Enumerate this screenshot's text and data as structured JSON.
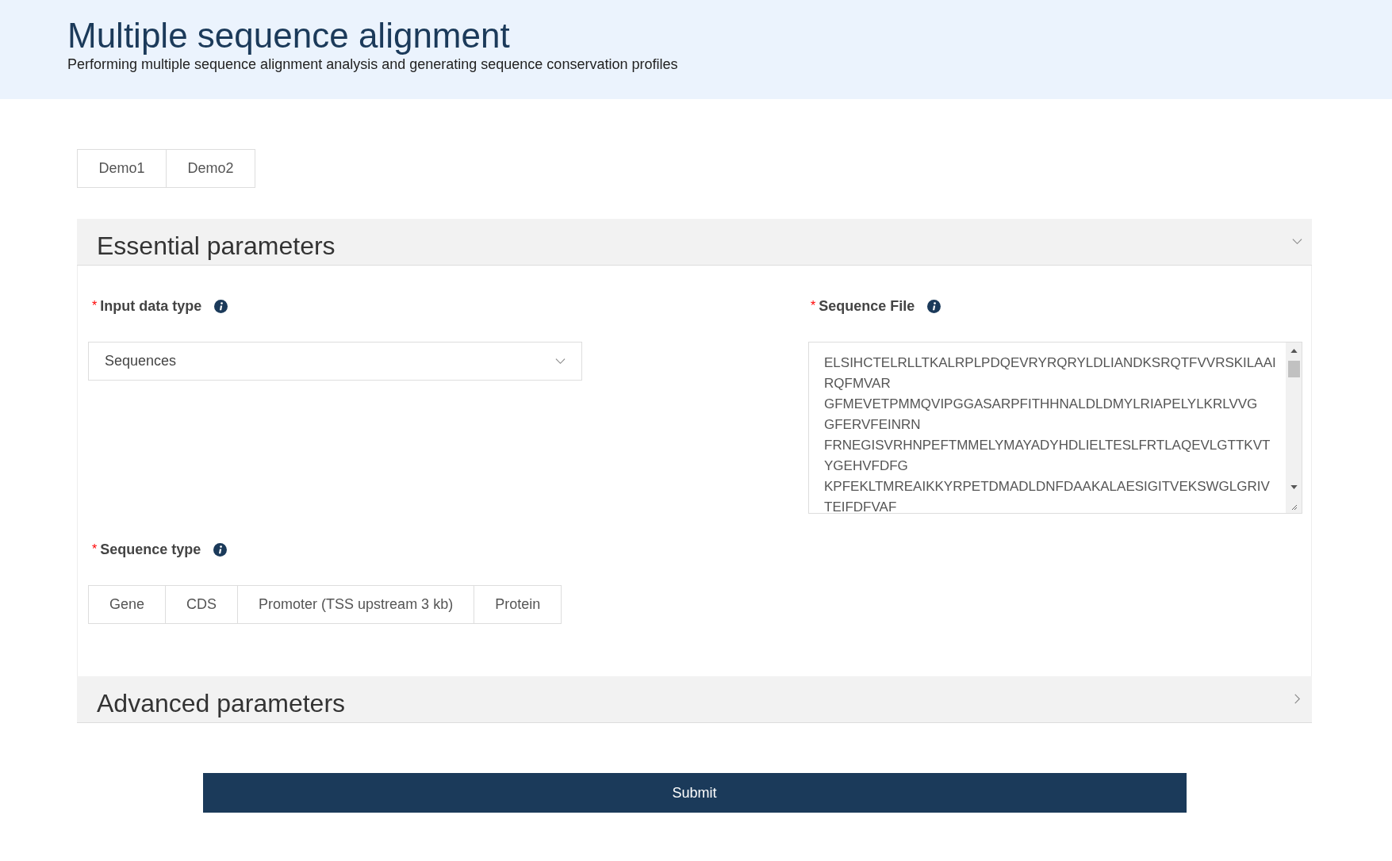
{
  "header": {
    "title": "Multiple sequence alignment",
    "subtitle": "Performing multiple sequence alignment analysis and generating sequence conservation profiles"
  },
  "demo_buttons": [
    "Demo1",
    "Demo2"
  ],
  "sections": [
    {
      "title": "Essential parameters",
      "expanded": true,
      "input_data_type": {
        "required_mark": "*",
        "label": "Input data type",
        "value": "Sequences"
      },
      "sequence_file": {
        "required_mark": "*",
        "label": "Sequence File",
        "lines": [
          "ELSIHCTELRLLTKALRPLPDQEVRYRQRYLDLIANDKSRQTFVVRSKILAAI",
          "RQFMVAR",
          "GFMEVETPMMQVIPGGASARPFITHHNALDLDMYLRIAPELYLKRLVVG",
          "GFERVFEINRN",
          "FRNEGISVRHNPEFTMMELYMAYADYHDLIELTESLFRTLAQEVLGTTKVT",
          "YGEHVFDFG",
          "KPFEKLTMREAIKKYRPETDMADLDNFDAAKALAESIGITVEKSWGLGRIV",
          "TEIFDFVAF"
        ]
      },
      "sequence_type": {
        "required_mark": "*",
        "label": "Sequence type",
        "options": [
          {
            "label": "Gene",
            "selected": false
          },
          {
            "label": "CDS",
            "selected": false
          },
          {
            "label": "Promoter (TSS upstream 3 kb)",
            "selected": false
          },
          {
            "label": "Protein",
            "selected": false
          }
        ]
      }
    },
    {
      "title": "Advanced parameters",
      "expanded": false
    }
  ],
  "submit": "Submit"
}
